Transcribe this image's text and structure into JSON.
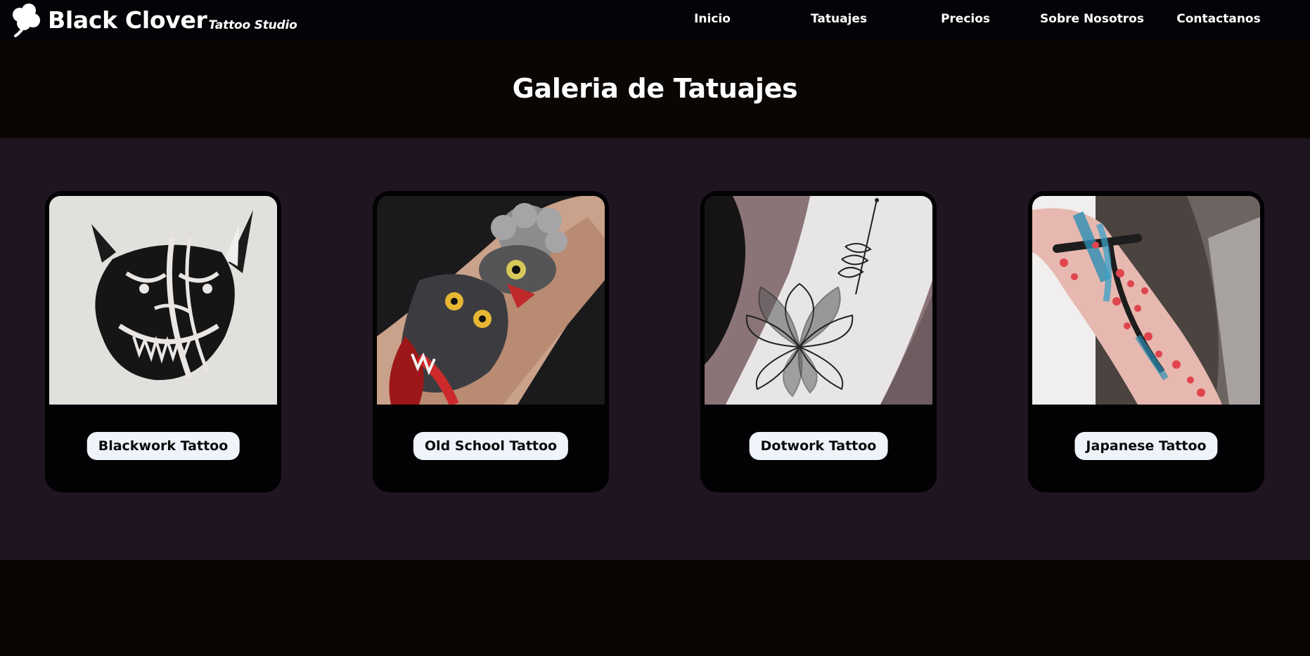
{
  "brand": {
    "name": "Black Clover",
    "tagline": "Tattoo Studio",
    "logo_icon": "clover-icon"
  },
  "nav": {
    "items": [
      {
        "label": "Inicio"
      },
      {
        "label": "Tatuajes"
      },
      {
        "label": "Precios"
      },
      {
        "label": "Sobre Nosotros"
      },
      {
        "label": "Contactanos"
      }
    ]
  },
  "gallery": {
    "title": "Galeria de Tatuajes",
    "cards": [
      {
        "label": "Blackwork Tattoo",
        "image": "blackwork-tattoo-photo"
      },
      {
        "label": "Old School Tattoo",
        "image": "old-school-tattoo-photo"
      },
      {
        "label": "Dotwork Tattoo",
        "image": "dotwork-tattoo-photo"
      },
      {
        "label": "Japanese Tattoo",
        "image": "japanese-tattoo-photo"
      }
    ]
  },
  "colors": {
    "navbar_bg": "#040307",
    "page_bg": "#090604",
    "gallery_bg": "#1f1520",
    "card_bg": "#020103",
    "label_bg": "#eff4fb"
  }
}
